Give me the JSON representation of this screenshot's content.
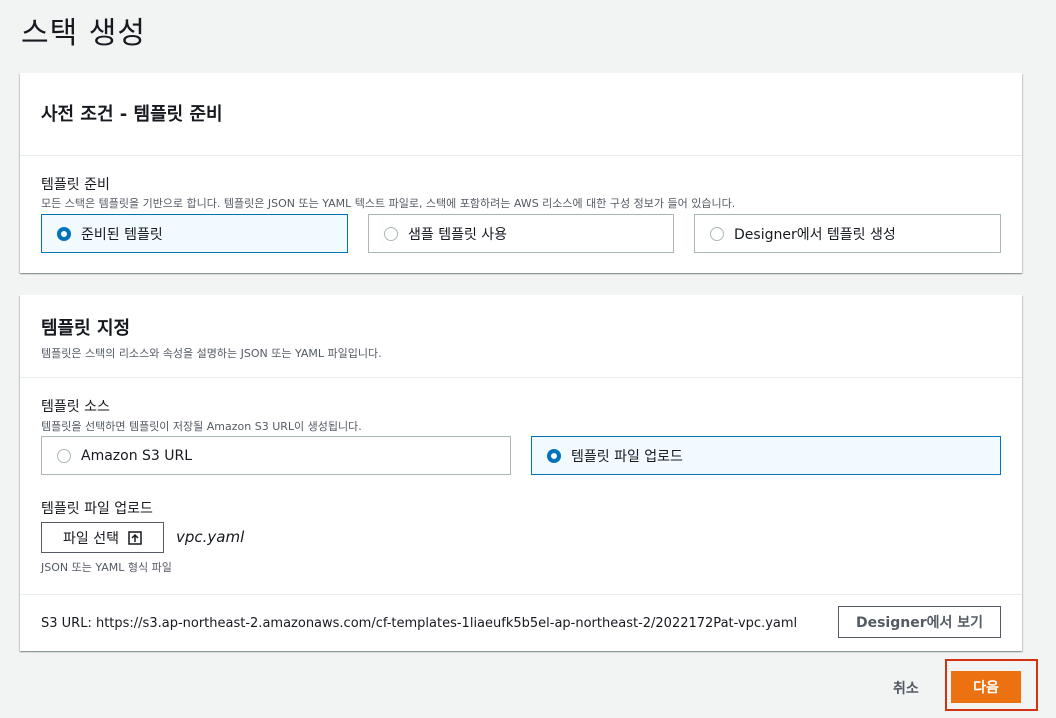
{
  "page": {
    "title": "스택 생성"
  },
  "prerequisite": {
    "title": "사전 조건 - 템플릿 준비",
    "field_label": "템플릿 준비",
    "field_desc": "모든 스택은 템플릿을 기반으로 합니다. 템플릿은 JSON 또는 YAML 텍스트 파일로, 스택에 포함하려는 AWS 리소스에 대한 구성 정보가 들어 있습니다.",
    "options": [
      {
        "label": "준비된 템플릿",
        "selected": true
      },
      {
        "label": "샘플 템플릿 사용",
        "selected": false
      },
      {
        "label": "Designer에서 템플릿 생성",
        "selected": false
      }
    ]
  },
  "specify": {
    "title": "템플릿 지정",
    "desc": "템플릿은 스택의 리소스와 속성을 설명하는 JSON 또는 YAML 파일입니다.",
    "source_label": "템플릿 소스",
    "source_desc": "템플릿을 선택하면 템플릿이 저장될 Amazon S3 URL이 생성됩니다.",
    "source_options": [
      {
        "label": "Amazon S3 URL",
        "selected": false
      },
      {
        "label": "템플릿 파일 업로드",
        "selected": true
      }
    ],
    "upload_label": "템플릿 파일 업로드",
    "choose_file_label": "파일 선택",
    "file_name": "vpc.yaml",
    "file_hint": "JSON 또는 YAML 형식 파일",
    "s3_url_text": "S3 URL:  https://s3.ap-northeast-2.amazonaws.com/cf-templates-1liaeufk5b5el-ap-northeast-2/2022172Pat-vpc.yaml",
    "designer_button": "Designer에서 보기"
  },
  "footer": {
    "cancel_label": "취소",
    "next_label": "다음"
  },
  "colors": {
    "accent": "#0073bb",
    "primary_button": "#ec7211",
    "highlight_box": "#d13212"
  }
}
